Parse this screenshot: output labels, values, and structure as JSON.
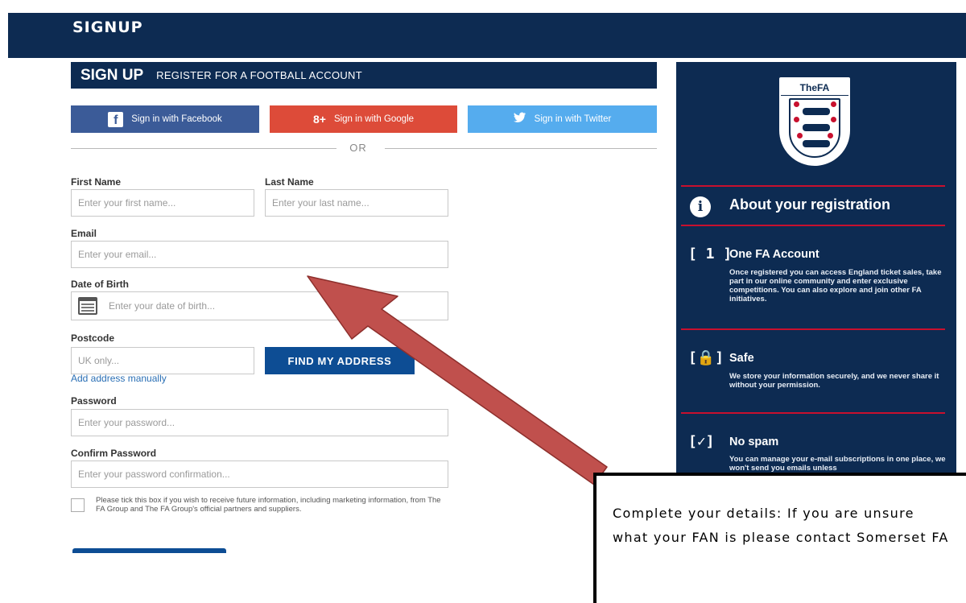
{
  "topbar": {
    "brand": "SIGNUP"
  },
  "form": {
    "header_main": "SIGN UP",
    "header_sub": "REGISTER FOR A FOOTBALL ACCOUNT",
    "social": {
      "facebook_label": "Sign in with Facebook",
      "google_label": "Sign in with Google",
      "twitter_label": "Sign in with Twitter",
      "facebook_icon": "f",
      "google_icon": "8+",
      "twitter_icon": "🐦"
    },
    "or_label": "OR",
    "first_name_label": "First Name",
    "first_name_placeholder": "Enter your first name...",
    "last_name_label": "Last Name",
    "last_name_placeholder": "Enter your last name...",
    "email_label": "Email",
    "email_placeholder": "Enter your email...",
    "dob_label": "Date of Birth",
    "dob_placeholder": "Enter your date of birth...",
    "postcode_label": "Postcode",
    "postcode_placeholder": "UK only...",
    "find_address_label": "FIND MY ADDRESS",
    "add_manual_label": "Add address manually",
    "password_label": "Password",
    "password_placeholder": "Enter your password...",
    "confirm_label": "Confirm Password",
    "confirm_placeholder": "Enter your password confirmation...",
    "consent_text": "Please tick this box if you wish to receive future information, including marketing information, from The FA Group and The FA Group's official partners and suppliers."
  },
  "sidebar": {
    "crest_title": "TheFA",
    "about_icon": "i",
    "about_title": "About your registration",
    "items": [
      {
        "bracket": "[ 1 ]",
        "title": "One FA Account",
        "desc": "Once registered you can access England ticket sales, take part in our online community and enter exclusive competitions. You can also explore and join other FA initiatives."
      },
      {
        "bracket": "[🔒]",
        "title": "Safe",
        "desc": "We store your information securely, and we never share it without your permission."
      },
      {
        "bracket": "[✓]",
        "title": "No spam",
        "desc": "You can manage your e-mail subscriptions in one place, we won't send you emails unless"
      }
    ]
  },
  "annotation": {
    "callout_text": "Complete your details: If you are unsure what your FAN is please contact Somerset FA",
    "arrow_color": "#c0504d"
  }
}
